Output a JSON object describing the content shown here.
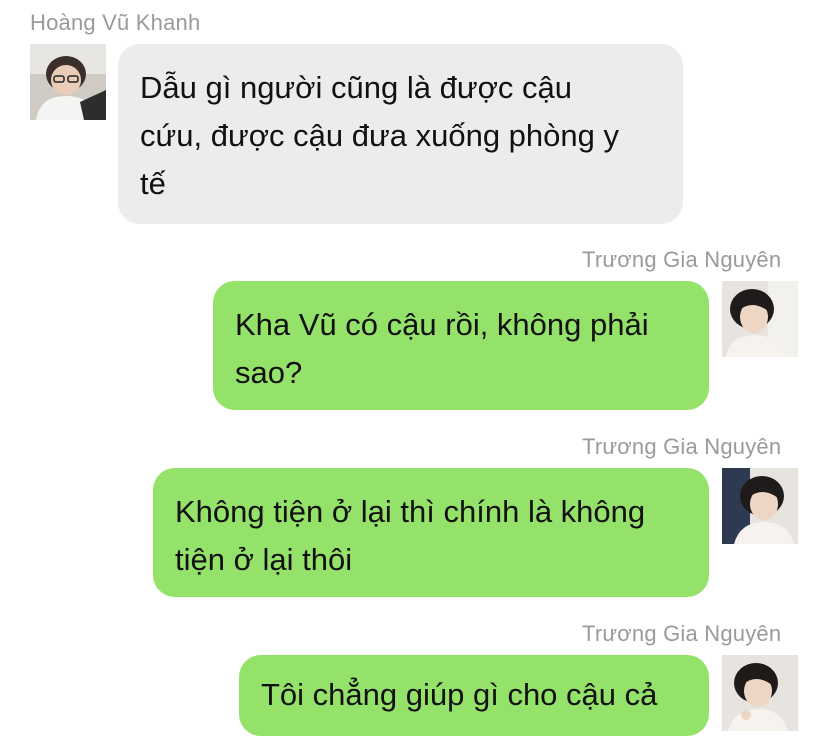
{
  "messages": [
    {
      "direction": "incoming",
      "sender": "Hoàng Vũ Khanh",
      "lines": [
        "Dẫu gì người cũng là được cậu",
        "cứu, được cậu đưa xuống phòng y",
        "tế"
      ]
    },
    {
      "direction": "outgoing",
      "sender": "Trương Gia Nguyên",
      "lines": [
        "Kha Vũ có cậu rồi, không phải",
        "sao?"
      ]
    },
    {
      "direction": "outgoing",
      "sender": "Trương Gia Nguyên",
      "lines": [
        "Không tiện ở lại thì chính là không",
        "tiện ở lại thôi"
      ]
    },
    {
      "direction": "outgoing",
      "sender": "Trương Gia Nguyên",
      "lines": [
        "Tôi chẳng giúp gì cho cậu cả"
      ]
    }
  ],
  "avatars": {
    "incoming": "avatar-photo-young-man-glasses",
    "outgoing": "avatar-photo-young-man-dark-hair"
  },
  "colors": {
    "incoming_bubble": "#ececee",
    "outgoing_bubble": "#95e26a",
    "sender_name": "#9a9a9a",
    "text": "#111111"
  }
}
